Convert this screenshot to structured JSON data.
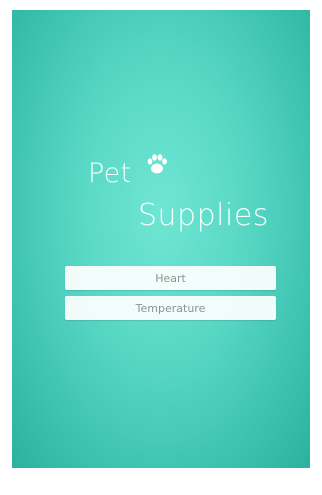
{
  "branding": {
    "line1": "Pet",
    "line2": "Supplies",
    "icon": "paw-icon"
  },
  "menu": {
    "items": [
      {
        "label": "Heart"
      },
      {
        "label": "Temperature"
      }
    ]
  },
  "colors": {
    "background_center": "#6fe6d3",
    "background_edge": "#2db19e",
    "text_primary": "#f7fffd",
    "button_background": "#ffffff",
    "button_text": "#8c9491"
  }
}
